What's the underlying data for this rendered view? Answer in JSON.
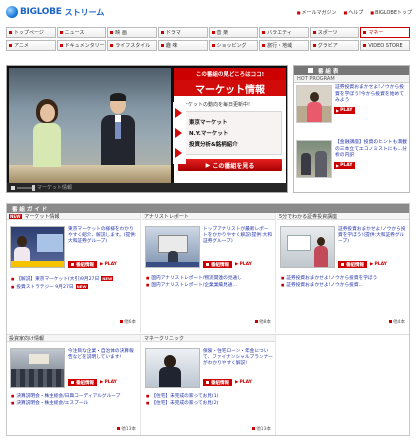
{
  "header": {
    "logo_text": "BIGLOBE",
    "service_name": "ストリーム",
    "links": [
      "メールマガジン",
      "ヘルプ",
      "BIGLOBEトップ"
    ]
  },
  "nav": {
    "row1": [
      {
        "label": "トップページ",
        "active": false
      },
      {
        "label": "ニュース",
        "active": false
      },
      {
        "label": "映 画",
        "active": false
      },
      {
        "label": "ドラマ",
        "active": false
      },
      {
        "label": "音 楽",
        "active": false
      },
      {
        "label": "バラエティ",
        "active": false
      },
      {
        "label": "スポーツ",
        "active": false
      },
      {
        "label": "マネー",
        "active": true
      }
    ],
    "row2": [
      {
        "label": "アニメ",
        "active": false
      },
      {
        "label": "ドキュメンタリー",
        "active": false
      },
      {
        "label": "ライフスタイル",
        "active": false
      },
      {
        "label": "趣 味",
        "active": false
      },
      {
        "label": "ショッピング",
        "active": false
      },
      {
        "label": "旅行・地域",
        "active": false
      },
      {
        "label": "グラビア",
        "active": false
      },
      {
        "label": "VIDEO STORE",
        "active": false
      }
    ]
  },
  "player": {
    "panel_header": "この番組の見どころはココ!",
    "program_title": "マーケット情報",
    "description": "マーケットの動向を毎日更新中!",
    "highlights": [
      "東京マーケット",
      "N.Y.マーケット",
      "投資分析&銘柄紹介"
    ],
    "cta": "この番組を見る",
    "caption": "マーケット情報"
  },
  "sidebar": {
    "title": "番 組 表",
    "subtitle": "HOT PROGRAM",
    "items": [
      {
        "text": "証券投資おまかせよ!ノウから投資を学ぼう!今から投資を始めてみよう",
        "play": "PLAY"
      },
      {
        "text": "【金融講座】投資のヒントも満載の三本立てエコノミストにも…分析の内訳",
        "play": "PLAY"
      }
    ]
  },
  "guide": {
    "title": "番 組 ガ イ ド",
    "info_label": "番組情報",
    "play_label": "PLAY",
    "sections": [
      {
        "title": "マーケット情報",
        "new_badge": "NEW",
        "desc": "東京マーケットの様様をわかりやすく紹介、解説します。(提供:大和証券グループ)",
        "links": [
          "【解説】東京マーケット(大引)9月27日",
          "投資ストラテジー 9月27日"
        ],
        "more": "他6本"
      },
      {
        "title": "アナリストレポート",
        "desc": "トップアナリストが最新レポートをかかりやすく解説(提供:大和証券グループ)",
        "links": [
          "国内アナリストレポート/物流関連の見通し",
          "国内アナリストレポート/企業業績見通…"
        ],
        "more": "他8本"
      },
      {
        "title": "5分でわかる証券投資講座",
        "desc": "証券投資おまかせよ!ノウから投資を学ぼう!(提供:大和証券グループ)",
        "links": [
          "証券投資おまかせよ!ノウから投資を学ぼう",
          "証券投資おまかせよ!ノウから投資…"
        ],
        "more": "他4本"
      },
      {
        "title": "投資家向け情報",
        "desc": "今注目な企業・自治体の決算報告などを説明しています!",
        "links": [
          "決算説明会・株主総会/日興コーディアルグループ",
          "決算説明会・株主総会/エスプール"
        ],
        "more": "他13本"
      },
      {
        "title": "マネークリニック",
        "desc": "保険・住宅ローン・年金について、ファイナンシャルプランナーがわかりやすく解説!",
        "links": [
          "【住宅】未完成の家ってお見(1)",
          "【住宅】未完成の家ってお見(2)"
        ],
        "more": "他13本"
      }
    ]
  }
}
